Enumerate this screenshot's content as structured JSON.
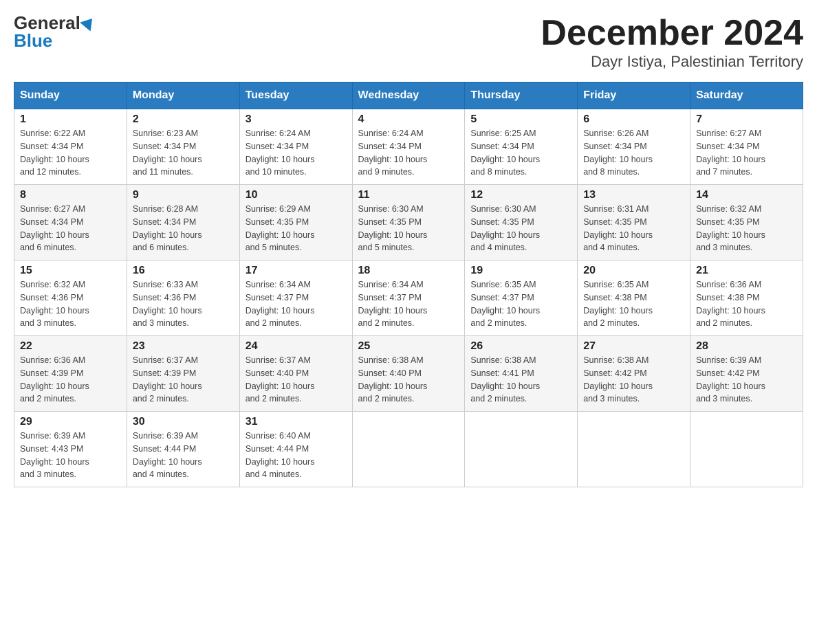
{
  "header": {
    "logo_general": "General",
    "logo_blue": "Blue",
    "month_title": "December 2024",
    "location": "Dayr Istiya, Palestinian Territory"
  },
  "weekdays": [
    "Sunday",
    "Monday",
    "Tuesday",
    "Wednesday",
    "Thursday",
    "Friday",
    "Saturday"
  ],
  "weeks": [
    [
      {
        "day": "1",
        "sunrise": "6:22 AM",
        "sunset": "4:34 PM",
        "daylight": "10 hours and 12 minutes."
      },
      {
        "day": "2",
        "sunrise": "6:23 AM",
        "sunset": "4:34 PM",
        "daylight": "10 hours and 11 minutes."
      },
      {
        "day": "3",
        "sunrise": "6:24 AM",
        "sunset": "4:34 PM",
        "daylight": "10 hours and 10 minutes."
      },
      {
        "day": "4",
        "sunrise": "6:24 AM",
        "sunset": "4:34 PM",
        "daylight": "10 hours and 9 minutes."
      },
      {
        "day": "5",
        "sunrise": "6:25 AM",
        "sunset": "4:34 PM",
        "daylight": "10 hours and 8 minutes."
      },
      {
        "day": "6",
        "sunrise": "6:26 AM",
        "sunset": "4:34 PM",
        "daylight": "10 hours and 8 minutes."
      },
      {
        "day": "7",
        "sunrise": "6:27 AM",
        "sunset": "4:34 PM",
        "daylight": "10 hours and 7 minutes."
      }
    ],
    [
      {
        "day": "8",
        "sunrise": "6:27 AM",
        "sunset": "4:34 PM",
        "daylight": "10 hours and 6 minutes."
      },
      {
        "day": "9",
        "sunrise": "6:28 AM",
        "sunset": "4:34 PM",
        "daylight": "10 hours and 6 minutes."
      },
      {
        "day": "10",
        "sunrise": "6:29 AM",
        "sunset": "4:35 PM",
        "daylight": "10 hours and 5 minutes."
      },
      {
        "day": "11",
        "sunrise": "6:30 AM",
        "sunset": "4:35 PM",
        "daylight": "10 hours and 5 minutes."
      },
      {
        "day": "12",
        "sunrise": "6:30 AM",
        "sunset": "4:35 PM",
        "daylight": "10 hours and 4 minutes."
      },
      {
        "day": "13",
        "sunrise": "6:31 AM",
        "sunset": "4:35 PM",
        "daylight": "10 hours and 4 minutes."
      },
      {
        "day": "14",
        "sunrise": "6:32 AM",
        "sunset": "4:35 PM",
        "daylight": "10 hours and 3 minutes."
      }
    ],
    [
      {
        "day": "15",
        "sunrise": "6:32 AM",
        "sunset": "4:36 PM",
        "daylight": "10 hours and 3 minutes."
      },
      {
        "day": "16",
        "sunrise": "6:33 AM",
        "sunset": "4:36 PM",
        "daylight": "10 hours and 3 minutes."
      },
      {
        "day": "17",
        "sunrise": "6:34 AM",
        "sunset": "4:37 PM",
        "daylight": "10 hours and 2 minutes."
      },
      {
        "day": "18",
        "sunrise": "6:34 AM",
        "sunset": "4:37 PM",
        "daylight": "10 hours and 2 minutes."
      },
      {
        "day": "19",
        "sunrise": "6:35 AM",
        "sunset": "4:37 PM",
        "daylight": "10 hours and 2 minutes."
      },
      {
        "day": "20",
        "sunrise": "6:35 AM",
        "sunset": "4:38 PM",
        "daylight": "10 hours and 2 minutes."
      },
      {
        "day": "21",
        "sunrise": "6:36 AM",
        "sunset": "4:38 PM",
        "daylight": "10 hours and 2 minutes."
      }
    ],
    [
      {
        "day": "22",
        "sunrise": "6:36 AM",
        "sunset": "4:39 PM",
        "daylight": "10 hours and 2 minutes."
      },
      {
        "day": "23",
        "sunrise": "6:37 AM",
        "sunset": "4:39 PM",
        "daylight": "10 hours and 2 minutes."
      },
      {
        "day": "24",
        "sunrise": "6:37 AM",
        "sunset": "4:40 PM",
        "daylight": "10 hours and 2 minutes."
      },
      {
        "day": "25",
        "sunrise": "6:38 AM",
        "sunset": "4:40 PM",
        "daylight": "10 hours and 2 minutes."
      },
      {
        "day": "26",
        "sunrise": "6:38 AM",
        "sunset": "4:41 PM",
        "daylight": "10 hours and 2 minutes."
      },
      {
        "day": "27",
        "sunrise": "6:38 AM",
        "sunset": "4:42 PM",
        "daylight": "10 hours and 3 minutes."
      },
      {
        "day": "28",
        "sunrise": "6:39 AM",
        "sunset": "4:42 PM",
        "daylight": "10 hours and 3 minutes."
      }
    ],
    [
      {
        "day": "29",
        "sunrise": "6:39 AM",
        "sunset": "4:43 PM",
        "daylight": "10 hours and 3 minutes."
      },
      {
        "day": "30",
        "sunrise": "6:39 AM",
        "sunset": "4:44 PM",
        "daylight": "10 hours and 4 minutes."
      },
      {
        "day": "31",
        "sunrise": "6:40 AM",
        "sunset": "4:44 PM",
        "daylight": "10 hours and 4 minutes."
      },
      null,
      null,
      null,
      null
    ]
  ],
  "labels": {
    "sunrise": "Sunrise:",
    "sunset": "Sunset:",
    "daylight": "Daylight:"
  }
}
